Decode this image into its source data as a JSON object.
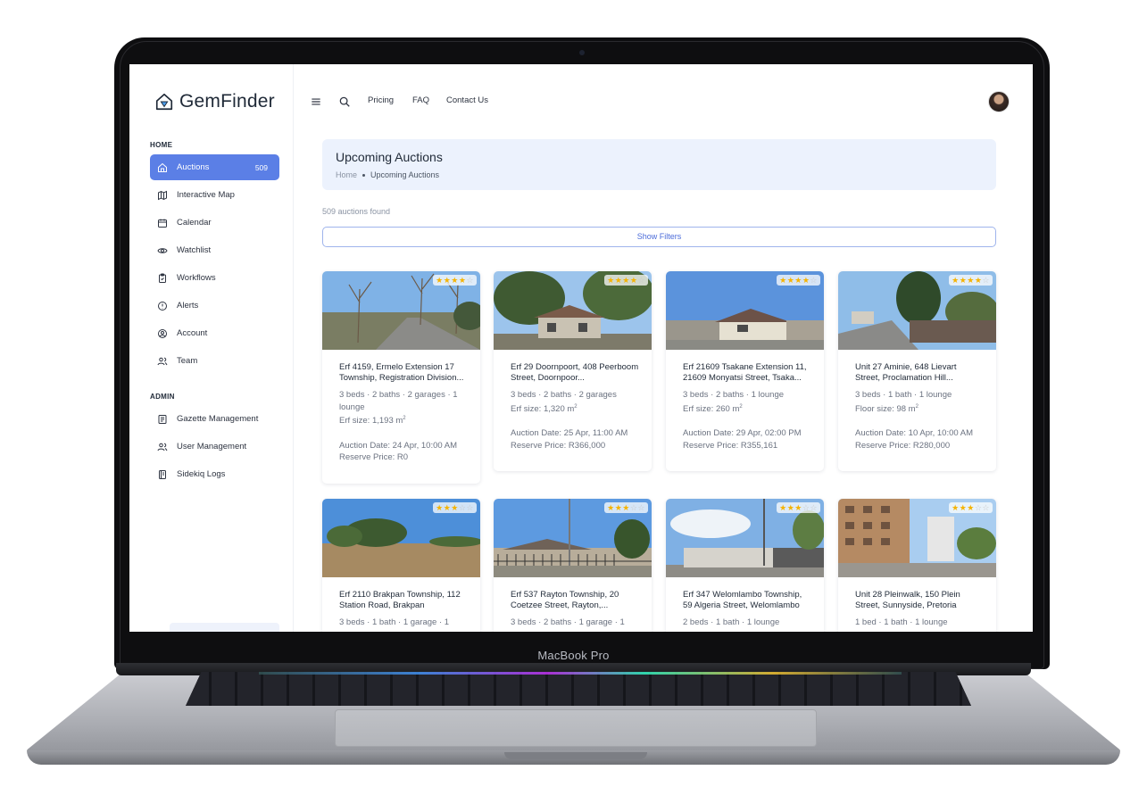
{
  "device_label": "MacBook Pro",
  "brand": {
    "name": "GemFinder",
    "accent": "#5b7fe6"
  },
  "topbar": {
    "links": [
      "Pricing",
      "FAQ",
      "Contact Us"
    ]
  },
  "sidebar": {
    "home_title": "HOME",
    "admin_title": "ADMIN",
    "home_items": [
      {
        "label": "Auctions",
        "icon": "home-icon",
        "count": "509",
        "active": true
      },
      {
        "label": "Interactive Map",
        "icon": "map-icon"
      },
      {
        "label": "Calendar",
        "icon": "calendar-icon"
      },
      {
        "label": "Watchlist",
        "icon": "eye-icon"
      },
      {
        "label": "Workflows",
        "icon": "clipboard-icon"
      },
      {
        "label": "Alerts",
        "icon": "alert-icon"
      },
      {
        "label": "Account",
        "icon": "user-circle-icon"
      },
      {
        "label": "Team",
        "icon": "users-icon"
      }
    ],
    "admin_items": [
      {
        "label": "Gazette Management",
        "icon": "newspaper-icon"
      },
      {
        "label": "User Management",
        "icon": "users-icon"
      },
      {
        "label": "Sidekiq Logs",
        "icon": "log-icon"
      }
    ]
  },
  "page": {
    "title": "Upcoming Auctions",
    "breadcrumb_home": "Home",
    "breadcrumb_current": "Upcoming Auctions",
    "results_count": "509 auctions found",
    "filters_button": "Show Filters"
  },
  "cards": [
    {
      "title": "Erf 4159, Ermelo Extension 17 Township, Registration Division...",
      "features": "3 beds · 2 baths · 2 garages · 1 lounge",
      "size": "Erf size: 1,193 m",
      "date": "Auction Date: 24 Apr, 10:00 AM",
      "price": "Reserve Price: R0",
      "rating": 4
    },
    {
      "title": "Erf 29 Doornpoort, 408 Peerboom Street, Doornpoor...",
      "features": "3 beds · 2 baths · 2 garages",
      "size": "Erf size: 1,320 m",
      "date": "Auction Date: 25 Apr, 11:00 AM",
      "price": "Reserve Price: R366,000",
      "rating": 4
    },
    {
      "title": "Erf 21609 Tsakane Extension 11, 21609 Monyatsi Street, Tsaka...",
      "features": "3 beds · 2 baths · 1 lounge",
      "size": "Erf size: 260 m",
      "date": "Auction Date: 29 Apr, 02:00 PM",
      "price": "Reserve Price: R355,161",
      "rating": 4
    },
    {
      "title": "Unit 27 Aminie, 648 Lievart Street, Proclamation Hill...",
      "features": "3 beds · 1 bath · 1 lounge",
      "size": "Floor size: 98 m",
      "date": "Auction Date: 10 Apr, 10:00 AM",
      "price": "Reserve Price: R280,000",
      "rating": 4
    },
    {
      "title": "Erf 2110 Brakpan Township, 112 Station Road, Brakpan",
      "features": "3 beds · 1 bath · 1 garage · 1",
      "size": "",
      "date": "",
      "price": "",
      "rating": 3
    },
    {
      "title": "Erf 537 Rayton Township, 20 Coetzee Street, Rayton,...",
      "features": "3 beds · 2 baths · 1 garage · 1",
      "size": "",
      "date": "",
      "price": "",
      "rating": 3
    },
    {
      "title": "Erf 347 Welomlambo Township, 59 Algeria Street, Welomlambo",
      "features": "2 beds · 1 bath · 1 lounge",
      "size": "",
      "date": "",
      "price": "",
      "rating": 3
    },
    {
      "title": "Unit 28 Pleinwalk, 150 Plein Street, Sunnyside, Pretoria",
      "features": "1 bed · 1 bath · 1 lounge",
      "size": "",
      "date": "",
      "price": "",
      "rating": 3
    }
  ]
}
